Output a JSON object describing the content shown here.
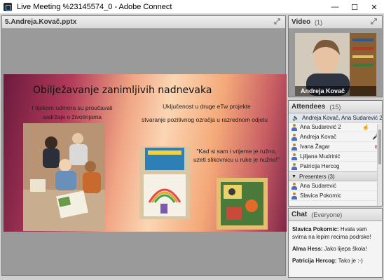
{
  "window": {
    "title": "Live Meeting %23145574_0 - Adobe Connect",
    "minimize": "—",
    "maximize": "☐",
    "close": "✕"
  },
  "share_pod": {
    "title": "5.Andreja.Kovač.pptx",
    "fullscreen_icon": "expand-icon"
  },
  "slide": {
    "title": "Obilježavanje zanimljivih nadnevaka",
    "left_text": "I tijekom odmora su proučavali sadržaje o životinjama",
    "middle_text": "Uključenost u druge eTw projekte",
    "middle_text2": "stvaranje pozitivnog ozračja u razrednom odjelu",
    "quote": "\"Kad si sam i vrijeme je ružno, uzeti slikovnicu u ruke je nužno!\""
  },
  "video_pod": {
    "title": "Video",
    "count": "(1)",
    "name": "Andreja Kovač"
  },
  "attendees_pod": {
    "title": "Attendees",
    "count": "(15)",
    "active_speakers": "Andreja Kovač, Ana Sudarević 2",
    "hosts": [
      {
        "name": "Ana Sudarević 2"
      },
      {
        "name": "Andreja Kovač"
      },
      {
        "name": "Ivana Žagar"
      },
      {
        "name": "Ljiljana Mudrinić"
      },
      {
        "name": "Patricija Hercog"
      }
    ],
    "presenters_header": "Presenters (3)",
    "presenters": [
      {
        "name": "Ana Sudarević"
      },
      {
        "name": "Slavica Pokornic"
      }
    ]
  },
  "chat_pod": {
    "title": "Chat",
    "scope": "(Everyone)",
    "messages": [
      {
        "sender": "Slavica Pokornic:",
        "text": " Hvala vam svima na lepim recima podrske!"
      },
      {
        "sender": "Alma Hess:",
        "text": " Jako lijepa škola!"
      },
      {
        "sender": "Patricija Hercog:",
        "text": " Tako je :-)"
      }
    ]
  }
}
